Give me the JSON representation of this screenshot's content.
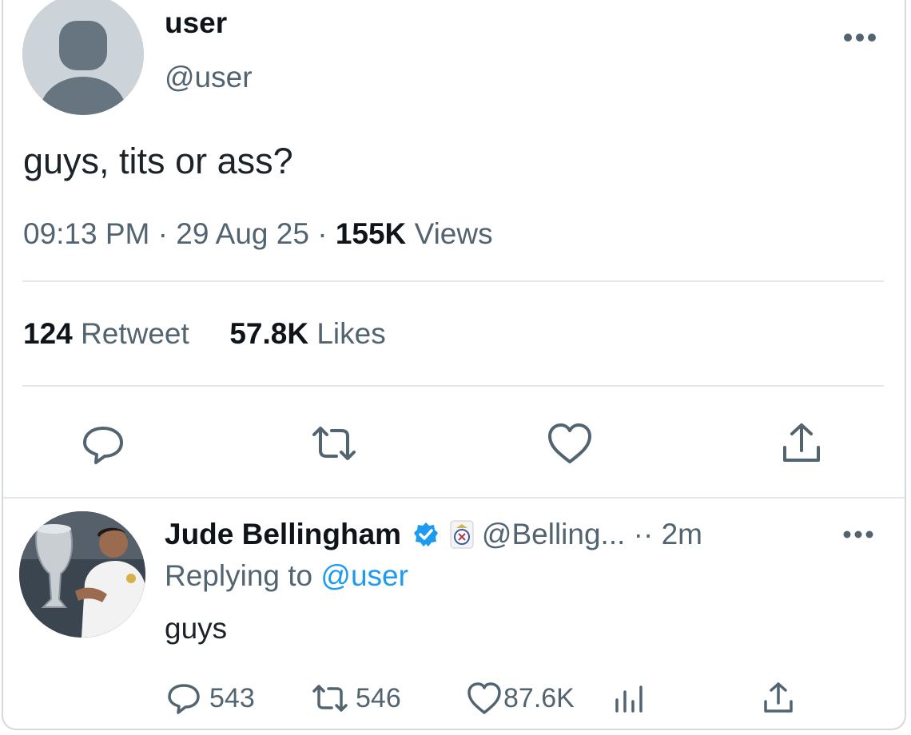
{
  "tweet": {
    "display_name": "user",
    "handle": "@user",
    "text": "guys, tits or ass?",
    "time": "09:13 PM",
    "date": "29 Aug 25",
    "views_count": "155K",
    "views_label": "Views",
    "retweets_count": "124",
    "retweets_label": "Retweet",
    "likes_count": "57.8K",
    "likes_label": "Likes",
    "more_icon": "ellipsis-icon",
    "actions": [
      "reply-icon",
      "retweet-icon",
      "like-icon",
      "share-icon"
    ]
  },
  "reply": {
    "display_name": "Jude Bellingham",
    "verified_icon": "verified-badge-icon",
    "affiliate_icon": "club-crest-icon",
    "handle": "@Belling...",
    "separator": "·· ",
    "time_ago": "2m",
    "replying_prefix": "Replying to",
    "replying_to": "@user",
    "text": "guys",
    "reply_count": "543",
    "retweet_count": "546",
    "like_count": "87.6K",
    "more_icon": "ellipsis-icon"
  },
  "colors": {
    "text_primary": "#0f1419",
    "text_secondary": "#536471",
    "link": "#1d9bf0",
    "divider": "#e4e7ea",
    "avatar_placeholder": "#ccd3d9"
  }
}
